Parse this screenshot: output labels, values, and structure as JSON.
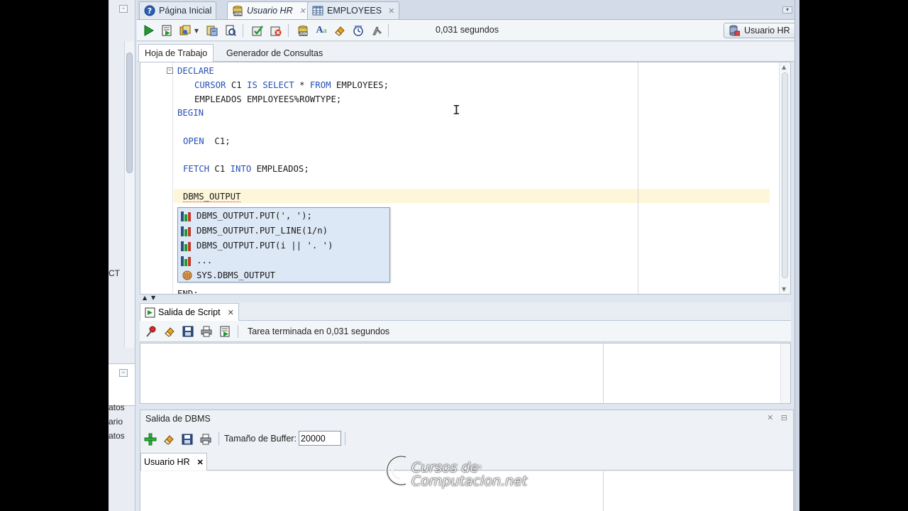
{
  "tabs": [
    {
      "label": "Página Inicial",
      "icon": "help-icon"
    },
    {
      "label": "Usuario HR",
      "icon": "sql-worksheet-icon"
    },
    {
      "label": "EMPLOYEES",
      "icon": "table-icon"
    }
  ],
  "toolbar": {
    "elapsed": "0,031 segundos",
    "connection": "Usuario HR"
  },
  "subtabs": [
    "Hoja de Trabajo",
    "Generador de Consultas"
  ],
  "editor": {
    "lines": [
      {
        "kw": "DECLARE"
      },
      {
        "parts": [
          {
            "k": "CURSOR"
          },
          {
            "t": " C1 "
          },
          {
            "k": "IS SELECT"
          },
          {
            "t": " * "
          },
          {
            "k": "FROM"
          },
          {
            "t": " EMPLOYEES;"
          }
        ]
      },
      {
        "parts": [
          {
            "t": "EMPLEADOS EMPLOYEES%ROWTYPE;"
          }
        ]
      },
      {
        "kw": "BEGIN"
      },
      {
        "parts": [
          {
            "k": "OPEN"
          },
          {
            "t": "  C1;"
          }
        ]
      },
      {
        "parts": [
          {
            "k": "FETCH"
          },
          {
            "t": " C1 "
          },
          {
            "k": "INTO"
          },
          {
            "t": " EMPLEADOS;"
          }
        ]
      },
      {
        "parts": [
          {
            "t": "DBMS_OUTPUT"
          }
        ]
      },
      {
        "parts": [
          {
            "t": "END;"
          }
        ]
      }
    ],
    "line_texts": {
      "l1": "DECLARE",
      "l2a": "CURSOR",
      "l2b": " C1 ",
      "l2c": "IS SELECT",
      "l2d": " * ",
      "l2e": "FROM",
      "l2f": " EMPLOYEES;",
      "l3": "EMPLEADOS EMPLOYEES%ROWTYPE;",
      "l4": "BEGIN",
      "l5a": "OPEN",
      "l5b": "  C1;",
      "l6a": "FETCH",
      "l6b": " C1 ",
      "l6c": "INTO",
      "l6d": " EMPLEADOS;",
      "l7": "DBMS_OUTPUT",
      "l8": "END;"
    }
  },
  "completion": [
    {
      "label": "DBMS_OUTPUT.PUT(', ');",
      "icon": "snippet-icon"
    },
    {
      "label": "DBMS_OUTPUT.PUT_LINE(1/n)",
      "icon": "snippet-icon"
    },
    {
      "label": "DBMS_OUTPUT.PUT(i || '. ')",
      "icon": "snippet-icon"
    },
    {
      "label": "...",
      "icon": "snippet-icon"
    },
    {
      "label": "SYS.DBMS_OUTPUT",
      "icon": "package-icon"
    }
  ],
  "script_output": {
    "tab_label": "Salida de Script",
    "status": "Tarea terminada en 0,031 segundos"
  },
  "dbms_output": {
    "title": "Salida de DBMS",
    "buffer_label": "Tamaño de Buffer:",
    "buffer_value": "20000",
    "tab_label": "Usuario HR"
  },
  "left_panel_fragments": [
    "CT",
    "atos",
    "ario",
    "atos"
  ],
  "watermark": {
    "line1": "Cursos de",
    "line2": "Computacion.net"
  },
  "colors": {
    "keyword": "#2550b6",
    "popup_bg": "#dce8f5",
    "current_line": "#fdf6d9",
    "run_green": "#1f9a2d"
  }
}
